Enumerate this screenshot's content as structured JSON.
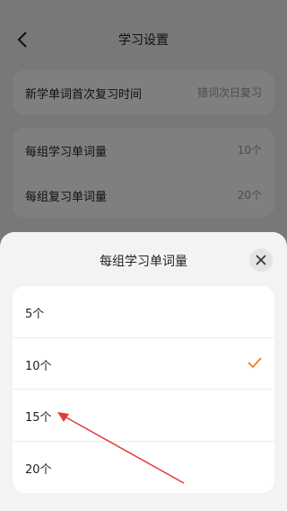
{
  "header": {
    "title": "学习设置",
    "back_icon": "chevron-left-icon"
  },
  "settings": {
    "review_time": {
      "label": "新学单词首次复习时间",
      "value": "错词次日复习"
    },
    "group_learn": {
      "label": "每组学习单词量",
      "value": "10个"
    },
    "group_review": {
      "label": "每组复习单词量",
      "value": "20个"
    }
  },
  "sheet": {
    "title": "每组学习单词量",
    "close_icon": "close-icon",
    "options": [
      {
        "label": "5个",
        "selected": false
      },
      {
        "label": "10个",
        "selected": true
      },
      {
        "label": "15个",
        "selected": false
      },
      {
        "label": "20个",
        "selected": false
      }
    ],
    "check_color": "#f07d2a"
  },
  "annotation": {
    "arrow_color": "#e03a3a"
  }
}
